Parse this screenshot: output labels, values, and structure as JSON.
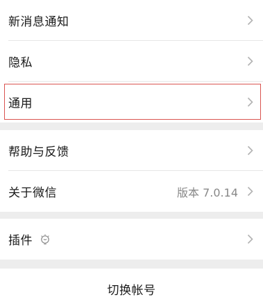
{
  "settings": {
    "group1": {
      "rows": [
        {
          "label": "新消息通知"
        },
        {
          "label": "隐私"
        },
        {
          "label": "通用"
        }
      ]
    },
    "group2": {
      "rows": [
        {
          "label": "帮助与反馈"
        },
        {
          "label": "关于微信",
          "value": "版本 7.0.14"
        }
      ]
    },
    "group3": {
      "rows": [
        {
          "label": "插件"
        }
      ]
    },
    "switch_account": {
      "label": "切换帐号"
    }
  },
  "icons": {
    "chevron": "chevron-right-icon",
    "plugin": "plugin-lightbulb-icon"
  },
  "colors": {
    "page_bg": "#ededed",
    "row_bg": "#ffffff",
    "text": "#1a1a1a",
    "secondary_text": "#888888",
    "chevron": "#b2b2b2",
    "highlight_border": "#d9534f"
  }
}
